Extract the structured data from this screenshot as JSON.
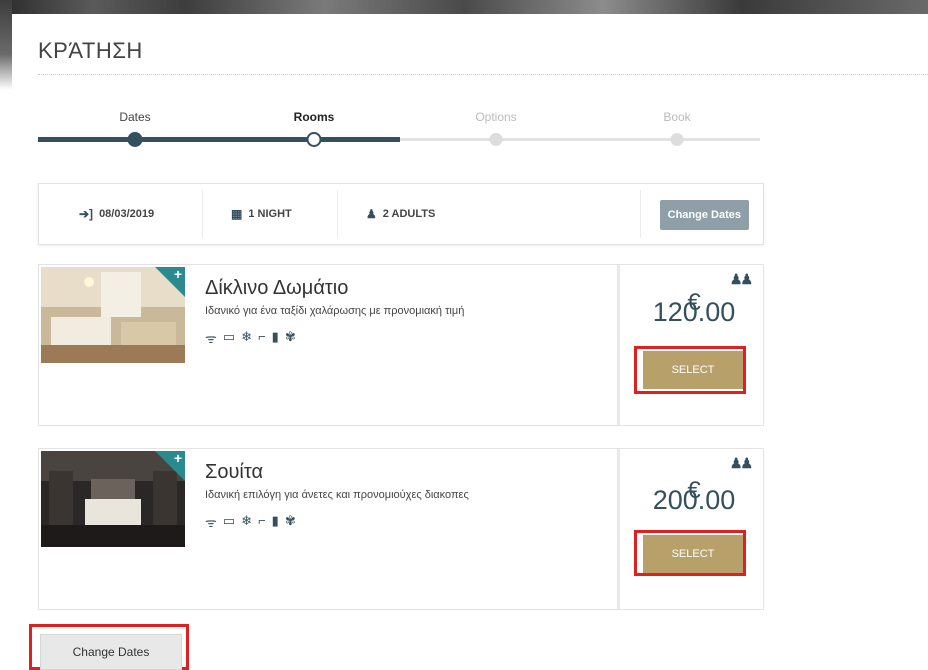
{
  "header": {
    "title": "ΚΡΆΤΗΣΗ"
  },
  "steps": [
    {
      "label": "Dates",
      "state": "done"
    },
    {
      "label": "Rooms",
      "state": "current"
    },
    {
      "label": "Options",
      "state": "future"
    },
    {
      "label": "Book",
      "state": "future"
    }
  ],
  "summary": {
    "checkin_icon": "sign-in-icon",
    "checkin": "08/03/2019",
    "nights_icon": "calendar-icon",
    "nights": "1 NIGHT",
    "adults_icon": "person-icon",
    "adults": "2 ADULTS",
    "change_label": "Change Dates"
  },
  "rooms": [
    {
      "name": "Δίκλινο Δωμάτιο",
      "description": "Ιδανικό για ένα ταξίδι χαλάρωσης με προνομιακή τιμή",
      "currency": "€",
      "price": "120.00",
      "select_label": "SELECT",
      "amenities": [
        "wifi-icon",
        "tv-icon",
        "ac-icon",
        "bath-icon",
        "coffee-icon",
        "pets-icon"
      ]
    },
    {
      "name": "Σουίτα",
      "description": "Ιδανική επιλόγη για άνετες και προνομιούχες διακοπες",
      "currency": "€",
      "price": "200.00",
      "select_label": "SELECT",
      "amenities": [
        "wifi-icon",
        "tv-icon",
        "ac-icon",
        "bath-icon",
        "coffee-icon",
        "pets-icon"
      ]
    }
  ],
  "footer": {
    "change_label": "Change Dates"
  },
  "colors": {
    "accent": "#34505f",
    "select_button": "#b8a06a",
    "highlight": "#e01f1f",
    "change_button_top": "#8e9fa8"
  }
}
